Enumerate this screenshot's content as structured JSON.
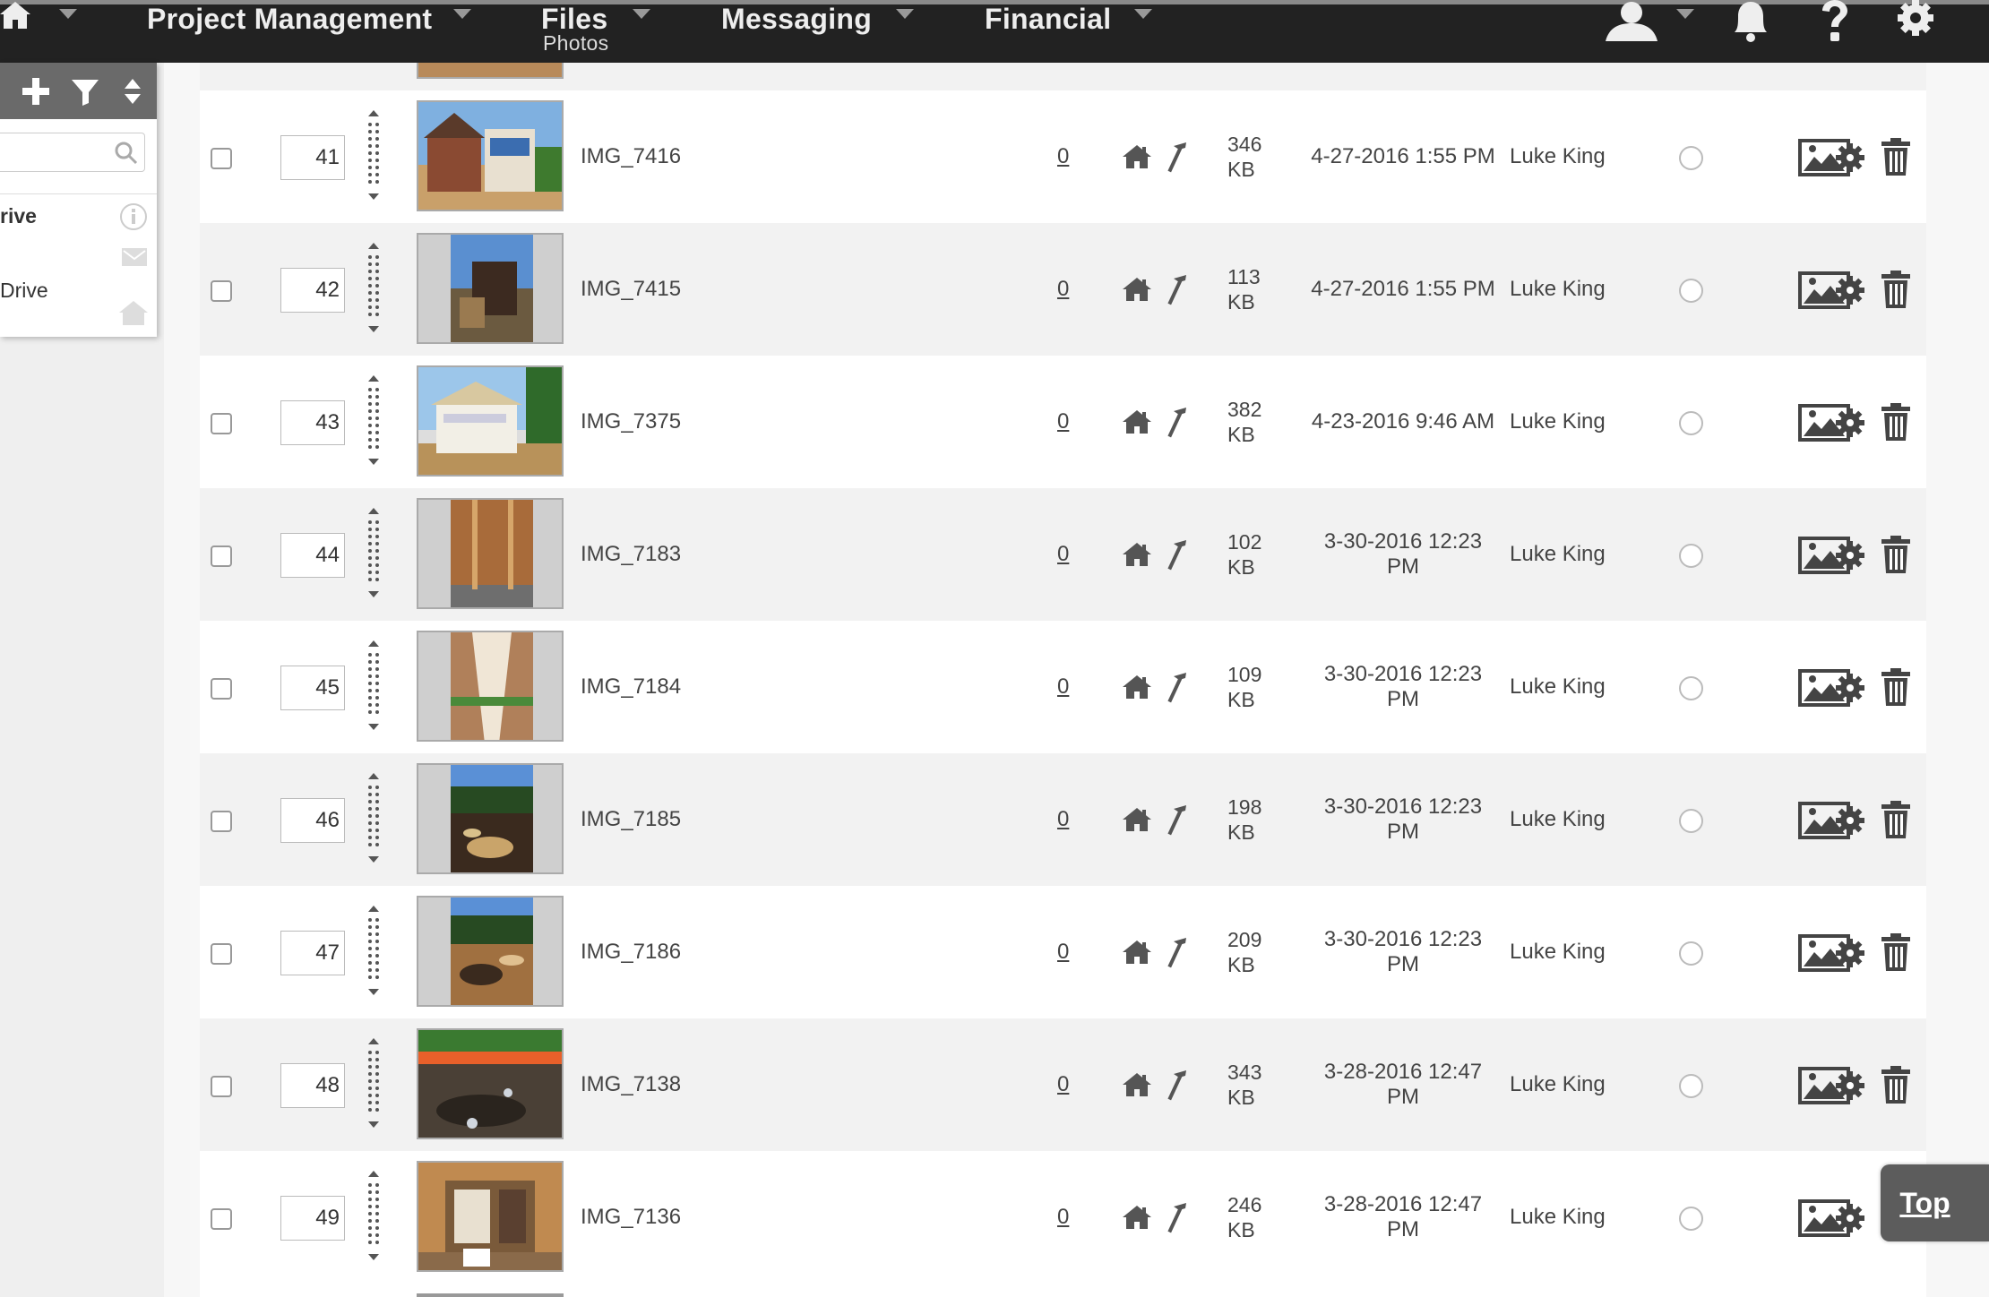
{
  "nav": {
    "items": [
      {
        "label": "Project Management",
        "sub": ""
      },
      {
        "label": "Files",
        "sub": "Photos"
      },
      {
        "label": "Messaging",
        "sub": ""
      },
      {
        "label": "Financial",
        "sub": ""
      }
    ],
    "icons": [
      "home-icon",
      "user-icon",
      "bell-icon",
      "help-icon",
      "settings-gear-icon"
    ]
  },
  "sidebar": {
    "toolbar_icons": [
      "add-icon",
      "filter-icon",
      "sort-icon"
    ],
    "search_placeholder": "",
    "items": [
      {
        "label": "rive",
        "icon": "info-icon"
      },
      {
        "label": "",
        "icon": "mail-icon"
      },
      {
        "label": "Drive",
        "icon": "home-icon"
      }
    ]
  },
  "rows": [
    {
      "order": "41",
      "name": "IMG_7416",
      "comments": "0",
      "size": "346",
      "unit": "KB",
      "date1": "4-27-2016 1:55 PM",
      "date2": "",
      "user": "Luke King"
    },
    {
      "order": "42",
      "name": "IMG_7415",
      "comments": "0",
      "size": "113",
      "unit": "KB",
      "date1": "4-27-2016 1:55 PM",
      "date2": "",
      "user": "Luke King"
    },
    {
      "order": "43",
      "name": "IMG_7375",
      "comments": "0",
      "size": "382",
      "unit": "KB",
      "date1": "4-23-2016 9:46 AM",
      "date2": "",
      "user": "Luke King"
    },
    {
      "order": "44",
      "name": "IMG_7183",
      "comments": "0",
      "size": "102",
      "unit": "KB",
      "date1": "3-30-2016 12:23",
      "date2": "PM",
      "user": "Luke King"
    },
    {
      "order": "45",
      "name": "IMG_7184",
      "comments": "0",
      "size": "109",
      "unit": "KB",
      "date1": "3-30-2016 12:23",
      "date2": "PM",
      "user": "Luke King"
    },
    {
      "order": "46",
      "name": "IMG_7185",
      "comments": "0",
      "size": "198",
      "unit": "KB",
      "date1": "3-30-2016 12:23",
      "date2": "PM",
      "user": "Luke King"
    },
    {
      "order": "47",
      "name": "IMG_7186",
      "comments": "0",
      "size": "209",
      "unit": "KB",
      "date1": "3-30-2016 12:23",
      "date2": "PM",
      "user": "Luke King"
    },
    {
      "order": "48",
      "name": "IMG_7138",
      "comments": "0",
      "size": "343",
      "unit": "KB",
      "date1": "3-28-2016 12:47",
      "date2": "PM",
      "user": "Luke King"
    },
    {
      "order": "49",
      "name": "IMG_7136",
      "comments": "0",
      "size": "246",
      "unit": "KB",
      "date1": "3-28-2016 12:47",
      "date2": "PM",
      "user": "Luke King"
    }
  ],
  "top_button": "Top"
}
